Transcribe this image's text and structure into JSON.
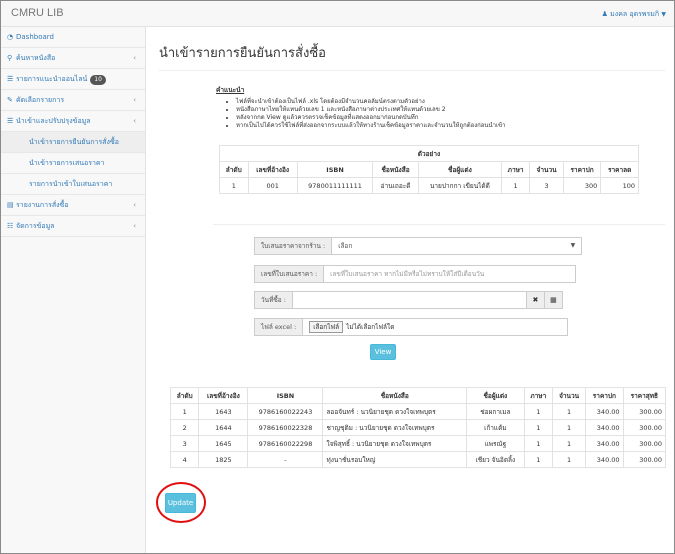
{
  "app": {
    "title": "CMRU LIB",
    "user_name": "มงคล อุดรพรมกิ"
  },
  "sidebar": {
    "items": [
      {
        "icon": "dashboard-icon",
        "label": "Dashboard"
      },
      {
        "icon": "search-icon",
        "label": "ค้นหาหนังสือ"
      },
      {
        "icon": "cart-icon",
        "label": "รายการแนะนำออนไลน์",
        "badge": "10"
      },
      {
        "icon": "edit-icon",
        "label": "คัดเลือกรายการ"
      },
      {
        "icon": "list-icon",
        "label": "นำเข้าและปรับปรุงข้อมูล"
      },
      {
        "icon": "chart-icon",
        "label": "รายงานการสั่งซื้อ"
      },
      {
        "icon": "settings-icon",
        "label": "จัดการข้อมูล"
      }
    ],
    "subitems": [
      "นำเข้ารายการยืนยันการสั่งซื้อ",
      "นำเข้ารายการเสนอราคา",
      "รายการนำเข้าใบเสนอราคา"
    ]
  },
  "page": {
    "title": "นำเข้ารายการยืนยันการสั่งซื้อ",
    "notes_heading": "คำแนะนำ",
    "notes": [
      "ไฟล์ที่จะนำเข้าต้องเป็นไฟล์ .xls โดยต้องมีจำนวนคอลัมน์ตรงตามตัวอย่าง",
      "หนังสือภาษาไทยให้แทนด้วยเลข 1 และหนังสือภาษาต่างประเทศให้แทนด้วยเลข 2",
      "หลังจากกด View ดูแล้วควรตรวจเช็คข้อมูลที่แสดงออกมาก่อนกดบันทึก",
      "หากเป็นไปได้ควรใช้ไฟล์ที่ส่งออกจากระบบแล้วให้ทางร้านเช็คข้อมูลราคาและจำนวนให้ถูกต้องก่อนนำเข้า"
    ]
  },
  "example_table": {
    "caption": "ตัวอย่าง",
    "headers": [
      "ลำดับ",
      "เลขที่อ้างอิง",
      "ISBN",
      "ชื่อหนังสือ",
      "ชื่อผู้แต่ง",
      "ภาษา",
      "จำนวน",
      "ราคาปก",
      "ราคาลด"
    ],
    "rows": [
      [
        "1",
        "001",
        "9780011111111",
        "อ่านเถอะดี",
        "นายปากกา เขียนได้ดี",
        "1",
        "3",
        "300",
        "100"
      ]
    ]
  },
  "form": {
    "vendor_label": "ใบเสนอราคาจากร้าน :",
    "vendor_value": "เลือก",
    "quote_label": "เลขที่ใบเสนอราคา :",
    "quote_placeholder": "เลขที่ใบเสนอราคา หากไม่มีหรือไม่ทราบให้ใส่ปีเดือนวัน",
    "date_label": "วันที่ซื้อ :",
    "file_label": "ไฟล์ excel :",
    "file_button": "เลือกไฟล์",
    "file_status": "ไม่ได้เลือกไฟล์ใด",
    "view_button": "View",
    "clear_icon": "times-icon",
    "calendar_icon": "calendar-icon"
  },
  "result_table": {
    "headers": [
      "ลำดับ",
      "เลขที่อ้างอิง",
      "ISBN",
      "ชื่อหนังสือ",
      "ชื่อผู้แต่ง",
      "ภาษา",
      "จำนวน",
      "ราคาปก",
      "ราคาสุทธิ"
    ],
    "rows": [
      [
        "1",
        "1643",
        "9786160022243",
        "ลออจันทร์ : นวนิยายชุด ดวงใจเทพบุตร",
        "ช่อผกาเมล",
        "1",
        "1",
        "340.00",
        "300.00"
      ],
      [
        "2",
        "1644",
        "9786160022328",
        "ชาญชุติม : นวนิยายชุด ดวงใจเทพบุตร",
        "เก้าแต้ม",
        "1",
        "1",
        "340.00",
        "300.00"
      ],
      [
        "3",
        "1645",
        "9786160022298",
        "ใจพิสุทธิ์ : นวนิยายชุด ดวงใจเทพบุตร",
        "แพรณัฐ",
        "1",
        "1",
        "340.00",
        "300.00"
      ],
      [
        "4",
        "1825",
        "-",
        "ทุ่งนาชั่นรอบใหญ่",
        "เชียว จันอิตลิ้ง",
        "1",
        "1",
        "340.00",
        "300.00"
      ]
    ]
  },
  "update_button": "Update",
  "colors": {
    "accent": "#5bc0de",
    "link": "#337ab7",
    "annotation": "#e01010"
  }
}
